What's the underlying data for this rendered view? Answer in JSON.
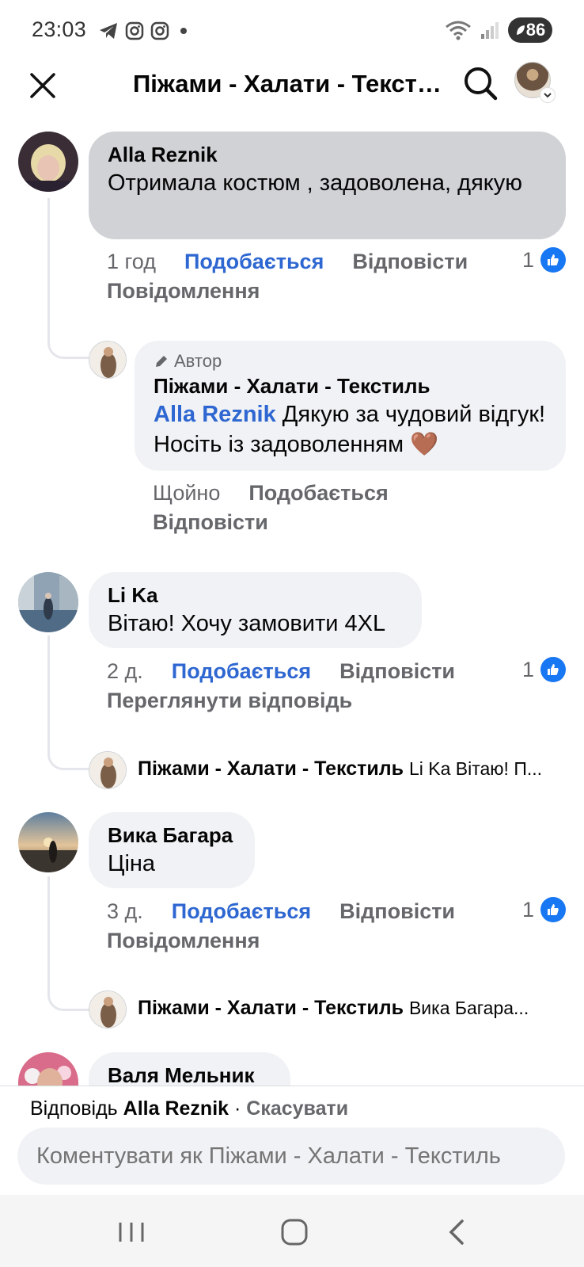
{
  "status_bar": {
    "time": "23:03",
    "battery": "86"
  },
  "app_bar": {
    "title": "Піжами - Халати - Текстиль"
  },
  "colors": {
    "link_blue": "#2e67d1",
    "like_blue": "#1877f2",
    "bubble_gray": "#e4e6eb",
    "selected_bubble": "#d0d2d6"
  },
  "comments": [
    {
      "author": "Alla Reznik",
      "text": "Отримала костюм , задоволена, дякую",
      "time": "1 год",
      "like": "Подобається",
      "reply": "Відповісти",
      "reactions": "1",
      "extra": "Повідомлення",
      "reply_item": {
        "badge": "Автор",
        "author": "Піжами - Халати - Текстиль",
        "mention": "Alla Reznik",
        "text": " Дякую за чудовий відгук! Носіть із задоволенням 🤎",
        "time": "Щойно",
        "like": "Подобається",
        "reply": "Відповісти"
      }
    },
    {
      "author": "Li Ka",
      "text": "Вітаю! Хочу замовити 4XL",
      "time": "2 д.",
      "like": "Подобається",
      "reply": "Відповісти",
      "reactions": "1",
      "extra": "Переглянути відповідь",
      "reply_preview": {
        "author": "Піжами - Халати - Текстиль",
        "text": "Li Ka Вітаю! П..."
      }
    },
    {
      "author": "Вика Багара",
      "text": "Ціна",
      "time": "3 д.",
      "like": "Подобається",
      "reply": "Відповісти",
      "reactions": "1",
      "extra": "Повідомлення",
      "reply_preview": {
        "author": "Піжами - Халати - Текстиль",
        "text": "Вика Багара..."
      }
    },
    {
      "author": "Валя Мельник"
    }
  ],
  "composer": {
    "replying_prefix": "Відповідь",
    "replying_to": "Alla Reznik",
    "separator": "·",
    "cancel": "Скасувати",
    "placeholder": "Коментувати як Піжами - Халати - Текстиль"
  }
}
